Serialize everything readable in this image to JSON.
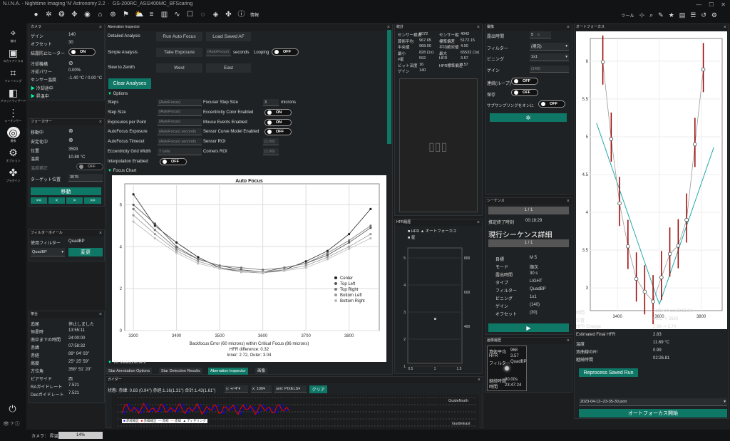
{
  "app": {
    "title_parts": [
      "N.I.N.A. - Nighttime Imaging 'N' Astronomy 2.2",
      "GS-200RC_ASI2400MC_BFScaring"
    ],
    "info_label": "情報",
    "tools_label": "ツール"
  },
  "left_nav": [
    {
      "label": "機材",
      "icon": "telescope-icon"
    },
    {
      "label": "スカイアトラス",
      "icon": "atlas-icon"
    },
    {
      "label": "フレーミング",
      "icon": "framing-icon"
    },
    {
      "label": "フラットウィザード",
      "icon": "flat-wizard-icon"
    },
    {
      "label": "シーケンサー",
      "icon": "sequencer-icon"
    },
    {
      "label": "撮像",
      "icon": "imaging-icon"
    },
    {
      "label": "オプション",
      "icon": "options-icon"
    },
    {
      "label": "プラグイン",
      "icon": "plugins-icon"
    }
  ],
  "camera": {
    "title": "カメラ",
    "rows": [
      {
        "label": "ゲイン",
        "value": "140"
      },
      {
        "label": "オフセット",
        "value": "30"
      },
      {
        "label": "結露防止ヒーター",
        "value": ""
      },
      {
        "label": "冷却機構",
        "value": ""
      },
      {
        "label": "冷却パワー",
        "value": "0.00%"
      },
      {
        "label": "センサー温度",
        "value": "-1.40 °C / 0.00 °C"
      }
    ],
    "heater": "ON",
    "cooling": "冷却途中",
    "warming": "昇温中"
  },
  "focuser": {
    "title": "フォーカサー",
    "rows": [
      {
        "label": "移動中",
        "value": ""
      },
      {
        "label": "安定化中",
        "value": ""
      },
      {
        "label": "位置",
        "value": "3593"
      },
      {
        "label": "温度",
        "value": "10.89 °C"
      },
      {
        "label": "温度補正",
        "value": ""
      }
    ],
    "temp_comp": "OFF",
    "target_label": "ターゲット位置",
    "target_value": "3575",
    "move_label": "移動",
    "step_buttons": [
      "<<",
      "<",
      ">",
      ">>"
    ]
  },
  "filterwheel": {
    "title": "フィルターホイール",
    "current_label": "使用フィルター",
    "current_value": "QuadBP",
    "select_value": "QuadBP",
    "change_label": "変更"
  },
  "tracking": {
    "title": "架台",
    "rows": [
      {
        "label": "追尾",
        "value": "停止しました"
      },
      {
        "label": "恒星時",
        "value": "13:55:11"
      },
      {
        "label": "南中までの時間",
        "value": "24:00:00"
      },
      {
        "label": "赤緯",
        "value": "07:58:32"
      },
      {
        "label": "赤経",
        "value": "89° 04' 03\""
      },
      {
        "label": "高度",
        "value": "25° 25' 59\""
      },
      {
        "label": "方位角",
        "value": "358° 51' 20\""
      },
      {
        "label": "ピアサイド",
        "value": "西"
      },
      {
        "label": "RAガイドレート",
        "value": "7.521"
      },
      {
        "label": "Decガイドレート",
        "value": "7.521"
      }
    ]
  },
  "aberration": {
    "title": "Aberration Inspector",
    "detailed_label": "Detailed Analysis",
    "run_af": "Run Auto Focus",
    "load_af": "Load Saved AF",
    "simple_label": "Simple Analysis",
    "take_exposure": "Take Exposure",
    "autofocus_ph": "(AutoFocus)",
    "seconds": "seconds",
    "looping": "Looping",
    "looping_state": "OFF",
    "slew_label": "Slew to Zenith",
    "west": "West",
    "east": "East",
    "clear": "Clear Analyses",
    "options": "Options",
    "opts_left": [
      {
        "label": "Steps",
        "value": "(AutoFocus)"
      },
      {
        "label": "Step Size",
        "value": "(AutoFocus)"
      },
      {
        "label": "Exposures per Point",
        "value": "(AutoFocus)"
      },
      {
        "label": "AutoFocus Exposure",
        "value": "(AutoFocus) seconds"
      },
      {
        "label": "AutoFocus Timeout",
        "value": "(AutoFocus) seconds"
      },
      {
        "label": "Eccentricity Grid Width",
        "value": "7  cells"
      },
      {
        "label": "Interpolation Enabled",
        "value": ""
      }
    ],
    "opts_right": [
      {
        "label": "Focuser Step Size",
        "value": "3",
        "unit": "microns"
      },
      {
        "label": "Eccentricity Color Enabled",
        "value": "ON"
      },
      {
        "label": "Mouse Events Enabled",
        "value": "ON"
      },
      {
        "label": "Sensor Curve Model Enabled",
        "value": "OFF"
      },
      {
        "label": "Sensor ROI",
        "value": "(1.00)"
      },
      {
        "label": "Corners ROI",
        "value": "(1.00)"
      }
    ],
    "interp_state": "OFF",
    "focus_chart": "Focus Chart",
    "tilt": "Tilt Measurement",
    "tabs": [
      "Star Annotation Options",
      "Star Detection Results",
      "Aberration Inspector",
      "画像"
    ]
  },
  "af_chart": {
    "title": "Auto Focus",
    "yticks": [
      "6",
      "4",
      "2",
      "0"
    ],
    "xticks": [
      "3300",
      "3400",
      "3500",
      "3600",
      "3700",
      "3800"
    ],
    "legend": [
      "Center",
      "Top Left",
      "Top Right",
      "Bottom Left",
      "Bottom Right"
    ],
    "caption": [
      "Backfocus Error (60 microns) within Critical Focus (86 microns)",
      "HFR difference: 0.32",
      "Inner: 2.72, Outer: 3.04"
    ]
  },
  "chart_data": {
    "type": "scatter",
    "title": "Auto Focus",
    "x": [
      3300,
      3350,
      3400,
      3450,
      3500,
      3550,
      3600,
      3650,
      3700,
      3750,
      3800,
      3850
    ],
    "series": [
      {
        "name": "Center",
        "values": [
          6.5,
          5.0,
          4.2,
          3.5,
          3.0,
          2.8,
          2.75,
          2.9,
          3.3,
          3.8,
          4.6,
          5.8
        ]
      },
      {
        "name": "Top Left",
        "values": [
          6.0,
          5.1,
          4.0,
          3.4,
          3.1,
          2.9,
          2.8,
          3.0,
          3.2,
          3.6,
          4.2,
          4.9
        ]
      },
      {
        "name": "Top Right",
        "values": [
          5.8,
          4.8,
          3.9,
          3.4,
          3.1,
          3.0,
          2.9,
          3.0,
          3.2,
          3.7,
          4.3,
          5.0
        ]
      },
      {
        "name": "Bottom Left",
        "values": [
          5.5,
          4.6,
          3.8,
          3.3,
          3.0,
          2.85,
          2.8,
          2.9,
          3.1,
          3.5,
          4.0,
          4.6
        ]
      },
      {
        "name": "Bottom Right",
        "values": [
          5.2,
          4.4,
          3.7,
          3.2,
          2.95,
          2.8,
          2.75,
          2.85,
          3.0,
          3.4,
          3.9,
          4.4
        ]
      }
    ],
    "xlim": [
      3280,
      3870
    ],
    "ylim": [
      0,
      7
    ]
  },
  "stats": {
    "title": "統計",
    "rows": [
      {
        "l1": "センサー横溝",
        "v1": "6072",
        "l2": "センサー縦",
        "v2": "4042"
      },
      {
        "l1": "算術平均",
        "v1": "967.65",
        "l2": "標準偏差",
        "v2": "5172.15"
      },
      {
        "l1": "中央値",
        "v1": "968.00",
        "l2": "平均絶対値",
        "v2": "4.00"
      },
      {
        "l1": "最小",
        "v1": "828 (1x)",
        "l2": "最大",
        "v2": "65532 (1x)"
      },
      {
        "l1": "#星",
        "v1": "592",
        "l2": "HFR",
        "v2": "3.57"
      },
      {
        "l1": "ビット深度",
        "v1": "16",
        "l2": "HFR標準偏差",
        "v2": "0.57"
      },
      {
        "l1": "ゲイン",
        "v1": "140",
        "l2": "",
        "v2": ""
      }
    ]
  },
  "hfr": {
    "title": "HFR履歴",
    "legend": [
      "HFR",
      "オートフォーカス",
      "星"
    ],
    "yleft": [
      "5",
      "4",
      "3",
      "2",
      "1"
    ],
    "yright": [
      "800",
      "600",
      "400"
    ],
    "xticks": [
      "0.5",
      "1",
      "1.5"
    ]
  },
  "imaging": {
    "title": "撮像",
    "rows": [
      {
        "label": "露出時間",
        "value": "5"
      },
      {
        "label": "フィルター",
        "value": "(現況)"
      },
      {
        "label": "ビニング",
        "value": "1x1"
      },
      {
        "label": "ゲイン",
        "value": "(140)"
      },
      {
        "label": "連続(ループ)",
        "value": "OFF"
      },
      {
        "label": "保存",
        "value": "OFF"
      },
      {
        "label": "サブサンプリングをオンに",
        "value": "OFF"
      }
    ],
    "exposure_unit": "s"
  },
  "sequence": {
    "title": "シーケンス",
    "progress1": "1 / 1",
    "eta_label": "推定終了時刻",
    "eta_value": "00:18:29",
    "detail_title": "現行シーケンス詳細",
    "progress2": "1 / 1",
    "rows": [
      {
        "label": "目標",
        "value": "M 5"
      },
      {
        "label": "モード",
        "value": "順次"
      },
      {
        "label": "露出時間",
        "value": "30 s"
      },
      {
        "label": "タイプ",
        "value": "LIGHT"
      },
      {
        "label": "フィルター",
        "value": "QuadBP"
      },
      {
        "label": "ビニング",
        "value": "1x1"
      },
      {
        "label": "ゲイン",
        "value": "(140)"
      },
      {
        "label": "オフセット",
        "value": "(30)"
      }
    ]
  },
  "image_history": {
    "title": "画像履歴",
    "rows": [
      {
        "label": "算術平均",
        "value": "968"
      },
      {
        "label": "HFR",
        "value": "3.57"
      },
      {
        "label": "フィルター",
        "value": "QuadBP"
      }
    ],
    "dur_label": "継続時間",
    "dur_value": "30.00s",
    "time_label": "時間",
    "time_value": "23:47:24"
  },
  "autofocus": {
    "title": "オートフォーカス",
    "yticks": [
      "6",
      "5.5",
      "5",
      "4.5",
      "4",
      "3.5",
      "3"
    ],
    "xticks": [
      "3400",
      "3600",
      "3800"
    ],
    "rows": [
      {
        "label": "時間",
        "value": "2023-04-12 23:35:30"
      },
      {
        "label": "位置",
        "value": "3611 -> 3593"
      },
      {
        "label": "HFR Change",
        "value": "2.98 -> 2.74"
      },
      {
        "label": "Estimated Final HFR",
        "value": "2.83"
      },
      {
        "label": "温度",
        "value": "11.69 °C"
      },
      {
        "label": "双曲線のR²",
        "value": "0.99"
      },
      {
        "label": "継続時間",
        "value": "02:26.81"
      }
    ],
    "reprocess": "Reprocess Saved Run",
    "file": "2023-04-12--23-35-30.json",
    "start": "オートフォーカス開始"
  },
  "guider": {
    "title": "ガイダー",
    "status": "状態:  赤緯: 0.83 (0.94\")  赤経:1.16(1.31\")  合計:1.43(1.61\")",
    "yrange": "y: +/-4\"",
    "xrange": "x: 100",
    "unit": "unit: PIXELS",
    "clear": "クリア",
    "north": "GuideNorth",
    "east": "GuideEast",
    "legend": [
      "赤経補正",
      "赤緯補正",
      "赤経",
      "赤緯",
      "ディザリング"
    ]
  },
  "status": {
    "camera": "カメラ：  昇温中",
    "progress": "14%"
  },
  "colors": {
    "accent": "#0f7766",
    "panel": "#1f2224",
    "bg": "#121314"
  }
}
